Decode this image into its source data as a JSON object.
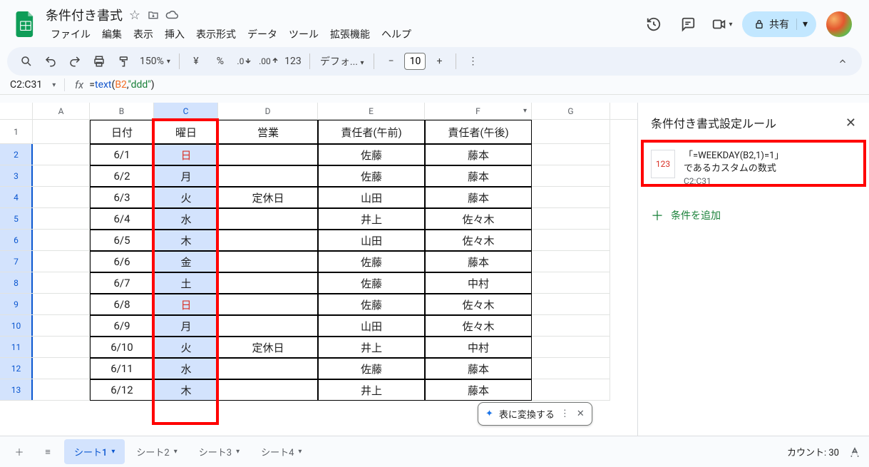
{
  "doc_title": "条件付き書式",
  "menus": [
    "ファイル",
    "編集",
    "表示",
    "挿入",
    "表示形式",
    "データ",
    "ツール",
    "拡張機能",
    "ヘルプ"
  ],
  "share_label": "共有",
  "toolbar": {
    "zoom": "150%",
    "currency": "¥",
    "percent": "%",
    "dec_dec": ".0",
    "dec_inc": ".00",
    "num": "123",
    "font": "デフォ...",
    "font_size": "10"
  },
  "namebox": "C2:C31",
  "formula": {
    "prefix": "=",
    "func": "text",
    "open": "(",
    "ref": "B2",
    "comma": ",",
    "str": "\"ddd\"",
    "close": ")"
  },
  "columns": [
    "A",
    "B",
    "C",
    "D",
    "E",
    "F",
    "G"
  ],
  "col_widths": {
    "A": 80,
    "B": 90,
    "C": 90,
    "D": 140,
    "E": 150,
    "F": 150,
    "G": 110
  },
  "header_row": {
    "B": "日付",
    "C": "曜日",
    "D": "営業",
    "E": "責任者(午前)",
    "F": "責任者(午後)"
  },
  "rows": [
    {
      "n": 2,
      "B": "6/1",
      "C": "日",
      "E": "佐藤",
      "F": "藤本",
      "sun": true
    },
    {
      "n": 3,
      "B": "6/2",
      "C": "月",
      "E": "佐藤",
      "F": "藤本"
    },
    {
      "n": 4,
      "B": "6/3",
      "C": "火",
      "D": "定休日",
      "E": "山田",
      "F": "藤本"
    },
    {
      "n": 5,
      "B": "6/4",
      "C": "水",
      "E": "井上",
      "F": "佐々木"
    },
    {
      "n": 6,
      "B": "6/5",
      "C": "木",
      "E": "山田",
      "F": "佐々木"
    },
    {
      "n": 7,
      "B": "6/6",
      "C": "金",
      "E": "佐藤",
      "F": "藤本"
    },
    {
      "n": 8,
      "B": "6/7",
      "C": "土",
      "E": "佐藤",
      "F": "中村"
    },
    {
      "n": 9,
      "B": "6/8",
      "C": "日",
      "E": "佐藤",
      "F": "佐々木",
      "sun": true
    },
    {
      "n": 10,
      "B": "6/9",
      "C": "月",
      "E": "山田",
      "F": "佐々木"
    },
    {
      "n": 11,
      "B": "6/10",
      "C": "火",
      "D": "定休日",
      "E": "井上",
      "F": "中村"
    },
    {
      "n": 12,
      "B": "6/11",
      "C": "水",
      "E": "佐藤",
      "F": "藤本"
    },
    {
      "n": 13,
      "B": "6/12",
      "C": "木",
      "E": "井上",
      "F": "藤本"
    }
  ],
  "side": {
    "title": "条件付き書式設定ルール",
    "rule_thumb": "123",
    "rule_line1": "「=WEEKDAY(B2,1)=1」",
    "rule_line2": "であるカスタムの数式",
    "rule_range": "C2:C31",
    "add": "条件を追加"
  },
  "tabs": [
    "シート1",
    "シート2",
    "シート3",
    "シート4"
  ],
  "status": "カウント: 30",
  "tip": {
    "label": "表に変換する"
  }
}
